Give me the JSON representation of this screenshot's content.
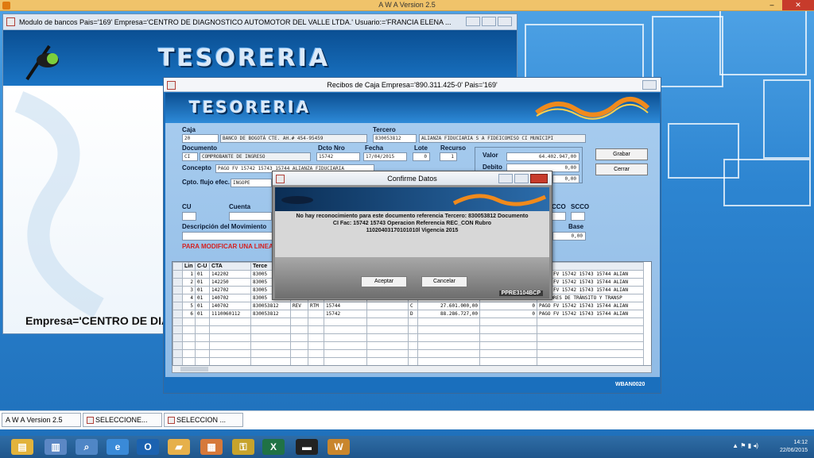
{
  "app": {
    "title": "A W A Version 2.5",
    "minimize": "–",
    "restore": "❐",
    "close": "✕"
  },
  "win1": {
    "title": "Modulo de bancos  Pais='169'  Empresa='CENTRO DE DIAGNOSTICO AUTOMOTOR DEL VALLE LTDA.'  Usuario:='FRANCIA ELENA ...",
    "banner_text": "TESORERIA",
    "empresa": "Empresa='CENTRO DE DIAG"
  },
  "win2": {
    "title": "Recibos de Caja   Empresa='890.311.425-0'  Pais='169'",
    "banner_text": "TESORERIA",
    "labels": {
      "caja": "Caja",
      "tercero": "Tercero",
      "documento": "Documento",
      "dcto_nro": "Dcto Nro",
      "fecha": "Fecha",
      "lote": "Lote",
      "recurso": "Recurso",
      "valor": "Valor",
      "debito": "Debito",
      "concepto": "Concepto",
      "cpto_flujo": "Cpto. flujo efec.",
      "cu": "CU",
      "cuenta": "Cuenta",
      "cco": "CCO",
      "scco": "SCCO",
      "descripcion": "Descripción del Movimiento",
      "base": "Base"
    },
    "values": {
      "caja_code": "20",
      "caja_name": "BANCO DE BOGOTÁ CTE. AH.# 454-95459",
      "tercero_code": "830053812",
      "tercero_name": "ALIANZA FIDUCIARIA S A FIDEICOMISO CI MUNICIPI",
      "doc_code": "CI",
      "doc_name": "COMPROBANTE DE INGRESO",
      "dcto_nro": "15742",
      "fecha": "17/04/2015",
      "lote": "0",
      "recurso": "1",
      "valor": "64.402.947,00",
      "debito": "0,00",
      "credito": "0,00",
      "concepto": "PAGO FV 15742 15743 15744 ALIANZA FIDUCIARIA",
      "cpto_flujo": "INGOPE",
      "base": "0,00"
    },
    "buttons": {
      "grabar": "Grabar",
      "cerrar": "Cerrar"
    },
    "red_note": "PARA MODIFICAR UNA LINEA",
    "grid": {
      "headers": [
        "Lin",
        "C-U",
        "CTA",
        "Terce",
        "",
        "",
        "",
        "",
        "",
        "",
        "",
        ""
      ],
      "rows": [
        [
          "1",
          "01",
          "142202",
          "83005",
          "",
          "",
          "",
          "",
          "",
          "",
          "",
          "PAGO FV 15742 15743 15744 ALIAN"
        ],
        [
          "2",
          "01",
          "142250",
          "83005",
          "",
          "",
          "",
          "",
          "",
          "",
          "",
          "PAGO FV 15742 15743 15744 ALIAN"
        ],
        [
          "3",
          "01",
          "142702",
          "83005",
          "",
          "",
          "",
          "",
          "",
          "",
          "",
          "PAGO FV 15742 15743 15744 ALIAN"
        ],
        [
          "4",
          "01",
          "140702",
          "83005",
          "",
          "",
          "",
          "",
          "",
          "",
          "",
          "DEUDORES DE TRÁNSITO Y TRANSP"
        ],
        [
          "5",
          "01",
          "140702",
          "830053812",
          "REV",
          "RTM",
          "15744",
          "",
          "C",
          "27.601.000,00",
          "0",
          "PAGO FV 15742 15743 15744 ALIAN"
        ],
        [
          "6",
          "01",
          "1110060112",
          "830053812",
          "",
          "",
          "15742",
          "",
          "D",
          "88.286.727,00",
          "0",
          "PAGO FV 15742 15743 15744 ALIAN"
        ]
      ]
    },
    "status_code": "WBAN0020"
  },
  "dialog": {
    "title": "Confirme Datos",
    "message_line1": "No hay reconocimiento para este documento referencia Tercero: 830053812   Documento",
    "message_line2": "CI   Fac: 15742   15743         Operacion Referencia   REC_CON Rubro",
    "message_line3": "11020403170101010l  Vigencia  2015",
    "accept": "Aceptar",
    "cancel": "Cancelar",
    "code": "PPRE3104BCP"
  },
  "mdi_tasks": [
    {
      "label": "A W A Version 2.5"
    },
    {
      "label": "SELECCIONE..."
    },
    {
      "label": "SELECCION ..."
    }
  ],
  "taskbar": {
    "icons": [
      {
        "name": "file-explorer-icon",
        "glyph": "▤",
        "color": "#e2b33c"
      },
      {
        "name": "document-icon",
        "glyph": "▥",
        "color": "#5b87c4"
      },
      {
        "name": "search-icon",
        "glyph": "⌕",
        "color": "#4f86c6"
      },
      {
        "name": "ie-icon",
        "glyph": "e",
        "color": "#3a8ad8"
      },
      {
        "name": "outlook-icon",
        "glyph": "O",
        "color": "#1b62b0"
      },
      {
        "name": "folder-icon",
        "glyph": "▰",
        "color": "#e6b04b"
      },
      {
        "name": "calculator-icon",
        "glyph": "▦",
        "color": "#d6793a"
      },
      {
        "name": "key-icon",
        "glyph": "⚿",
        "color": "#c7a32c"
      },
      {
        "name": "excel-icon",
        "glyph": "X",
        "color": "#207245"
      },
      {
        "name": "cmd-icon",
        "glyph": "▬",
        "color": "#222222"
      },
      {
        "name": "awa-icon",
        "glyph": "W",
        "color": "#c9862d"
      }
    ],
    "time": "14:12",
    "date": "22/06/2015",
    "tray": "▲ ⚑ ▮ ◂)"
  }
}
